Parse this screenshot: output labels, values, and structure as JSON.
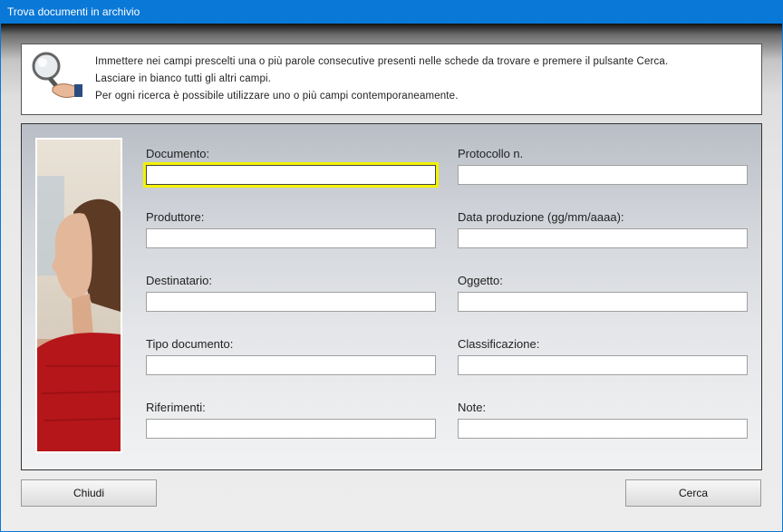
{
  "window": {
    "title": "Trova documenti in archivio"
  },
  "info": {
    "lines": [
      "Immettere nei campi prescelti una o più parole consecutive presenti nelle schede da trovare e premere il pulsante Cerca.",
      "Lasciare in bianco tutti gli altri campi.",
      "Per ogni ricerca è possibile utilizzare uno o più campi contemporaneamente."
    ]
  },
  "fields": {
    "documento": {
      "label": "Documento:",
      "value": ""
    },
    "protocollo": {
      "label": "Protocollo n.",
      "value": ""
    },
    "produttore": {
      "label": "Produttore:",
      "value": ""
    },
    "data_produzione": {
      "label": "Data produzione (gg/mm/aaaa):",
      "value": ""
    },
    "destinatario": {
      "label": "Destinatario:",
      "value": ""
    },
    "oggetto": {
      "label": "Oggetto:",
      "value": ""
    },
    "tipo_documento": {
      "label": "Tipo documento:",
      "value": ""
    },
    "classificazione": {
      "label": "Classificazione:",
      "value": ""
    },
    "riferimenti": {
      "label": "Riferimenti:",
      "value": ""
    },
    "note": {
      "label": "Note:",
      "value": ""
    }
  },
  "buttons": {
    "close_label": "Chiudi",
    "search_label": "Cerca"
  },
  "colors": {
    "titlebar": "#0a78d7",
    "focus_highlight": "#f2f200"
  }
}
